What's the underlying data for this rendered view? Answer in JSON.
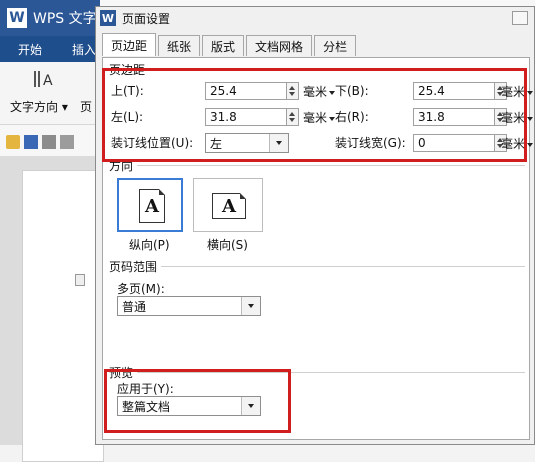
{
  "app": {
    "title": "WPS 文字",
    "tabs": [
      "开始",
      "插入"
    ],
    "ribbon_label": "文字方向",
    "ribbon_label2": "页"
  },
  "dialog": {
    "title": "页面设置",
    "tabs": [
      "页边距",
      "纸张",
      "版式",
      "文档网格",
      "分栏"
    ],
    "margins": {
      "group": "页边距",
      "top_label": "上(T):",
      "top_value": "25.4",
      "bottom_label": "下(B):",
      "bottom_value": "25.4",
      "left_label": "左(L):",
      "left_value": "31.8",
      "right_label": "右(R):",
      "right_value": "31.8",
      "unit": "毫米",
      "gutter_pos_label": "装订线位置(U):",
      "gutter_pos_value": "左",
      "gutter_width_label": "装订线宽(G):",
      "gutter_width_value": "0"
    },
    "orientation": {
      "group": "方向",
      "portrait": "纵向(P)",
      "landscape": "横向(S)",
      "glyph": "A"
    },
    "pages": {
      "group": "页码范围",
      "multi_label": "多页(M):",
      "multi_value": "普通"
    },
    "preview": {
      "group": "预览",
      "apply_label": "应用于(Y):",
      "apply_value": "整篇文档"
    }
  },
  "colors": {
    "accent": "#2b5797",
    "highlight": "#d01d1d",
    "selected_border": "#3a7bd5"
  }
}
